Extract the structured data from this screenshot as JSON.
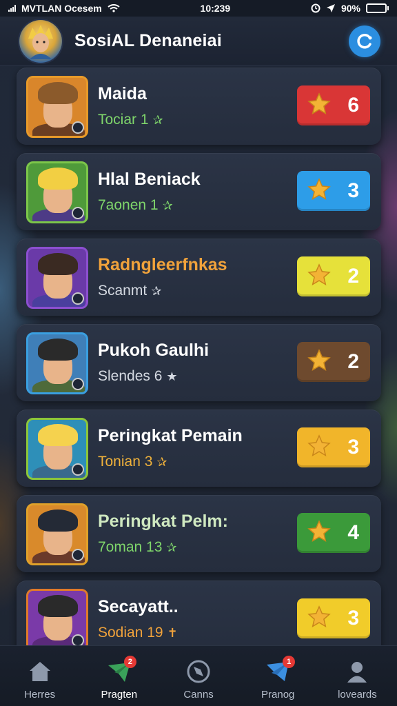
{
  "status_bar": {
    "carrier": "MVTLAN Ocesem",
    "time": "10:239",
    "battery": "90%",
    "battery_level": 0.9
  },
  "header": {
    "title": "SosiAL Denaneiai"
  },
  "players": [
    {
      "name": "Maida",
      "sub": "Tociar 1",
      "sub_icon": "✰",
      "name_color": "#ffffff",
      "sub_color": "#7fd66b",
      "frame_color": "#e79a2a",
      "bg": "#d9862b",
      "hair": "#8b5a2b",
      "shirt": "#6b3e22",
      "rank": "6",
      "badge_color": "#d93636"
    },
    {
      "name": "Hlal Beniack",
      "sub": "7aonen 1",
      "sub_icon": "✰",
      "name_color": "#ffffff",
      "sub_color": "#7fd66b",
      "frame_color": "#7cc64a",
      "bg": "#4f9a3a",
      "hair": "#f2cf43",
      "shirt": "#4d3b86",
      "rank": "3",
      "badge_color": "#2d9de8"
    },
    {
      "name": "Radngleerfnkas",
      "sub": "Scanmt",
      "sub_icon": "✰",
      "name_color": "#f0a23b",
      "sub_color": "#d5dae2",
      "frame_color": "#8c4fd0",
      "bg": "#6a3aa8",
      "hair": "#3a2a22",
      "shirt": "#4a3f9e",
      "rank": "2",
      "badge_color": "#e6e13a"
    },
    {
      "name": "Pukoh Gaulhi",
      "sub": "Slendes 6",
      "sub_icon": "★",
      "name_color": "#ffffff",
      "sub_color": "#d5dae2",
      "frame_color": "#3a9fe0",
      "bg": "#3f7fb8",
      "hair": "#2a2a2a",
      "shirt": "#4e6a3a",
      "rank": "2",
      "badge_color": "#6e4a2e"
    },
    {
      "name": "Peringkat Pemain",
      "sub": "Tonian 3",
      "sub_icon": "✰",
      "name_color": "#ffffff",
      "sub_color": "#f0b23b",
      "frame_color": "#8cc63a",
      "bg": "#2e8fb8",
      "hair": "#f5d24e",
      "shirt": "#3a6a8e",
      "rank": "3",
      "badge_color": "#f1b52a"
    },
    {
      "name": "Peringkat Pelm:",
      "sub": "7oman 13",
      "sub_icon": "✰",
      "name_color": "#cfe8c0",
      "sub_color": "#7fd66b",
      "frame_color": "#e0a12a",
      "bg": "#d98a2b",
      "hair": "#242a36",
      "shirt": "#6a3a2a",
      "rank": "4",
      "badge_color": "#3b9a3a"
    },
    {
      "name": "Secayatt..",
      "sub": "Sodian 19",
      "sub_icon": "✝",
      "name_color": "#ffffff",
      "sub_color": "#f0a23b",
      "frame_color": "#e07a2a",
      "bg": "#7a3aa8",
      "hair": "#2a2a2a",
      "shirt": "#5a2a7a",
      "rank": "3",
      "badge_color": "#f1cc2a"
    }
  ],
  "nav": [
    {
      "label": "Herres",
      "icon": "home-icon",
      "badge": ""
    },
    {
      "label": "Pragten",
      "icon": "paper-plane-icon",
      "badge": "2",
      "active": true
    },
    {
      "label": "Canns",
      "icon": "compass-icon",
      "badge": ""
    },
    {
      "label": "Pranog",
      "icon": "mail-icon",
      "badge": "1"
    },
    {
      "label": "loveards",
      "icon": "user-icon",
      "badge": ""
    }
  ]
}
